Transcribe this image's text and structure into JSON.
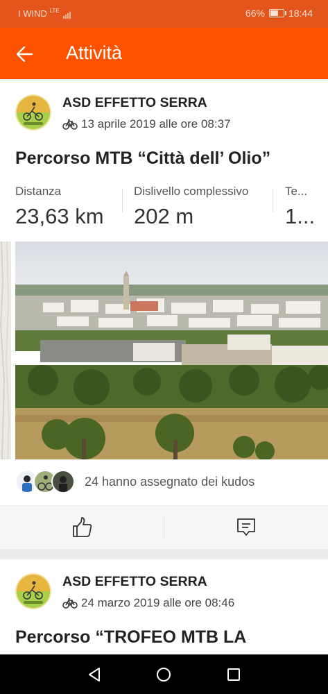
{
  "status": {
    "carrier": "I WIND",
    "network": "LTE",
    "battery": "66%",
    "battery_level": 0.66,
    "time": "18:44"
  },
  "appbar": {
    "title": "Attività"
  },
  "activities": [
    {
      "club": "ASD EFFETTO SERRA",
      "date": "13 aprile 2019 alle ore 08:37",
      "title": "Percorso MTB “Città dell’ Olio”",
      "stats": [
        {
          "label": "Distanza",
          "value": "23,63 km"
        },
        {
          "label": "Dislivello complessivo",
          "value": "202 m"
        },
        {
          "label": "Te...",
          "value": "1..."
        }
      ],
      "kudos": "24 hanno assegnato dei kudos"
    },
    {
      "club": "ASD EFFETTO SERRA",
      "date": "24 marzo 2019 alle ore 08:46",
      "title": "Percorso “TROFEO MTB LA"
    }
  ],
  "icons": {
    "back": "arrow-left-icon",
    "bike": "bicycle-icon",
    "kudos": "thumbs-up-icon",
    "comment": "comment-icon",
    "nav_back": "triangle-back-icon",
    "nav_home": "circle-home-icon",
    "nav_recents": "square-recents-icon"
  },
  "colors": {
    "brand": "#fc5200",
    "statusbar": "#e4551c"
  }
}
